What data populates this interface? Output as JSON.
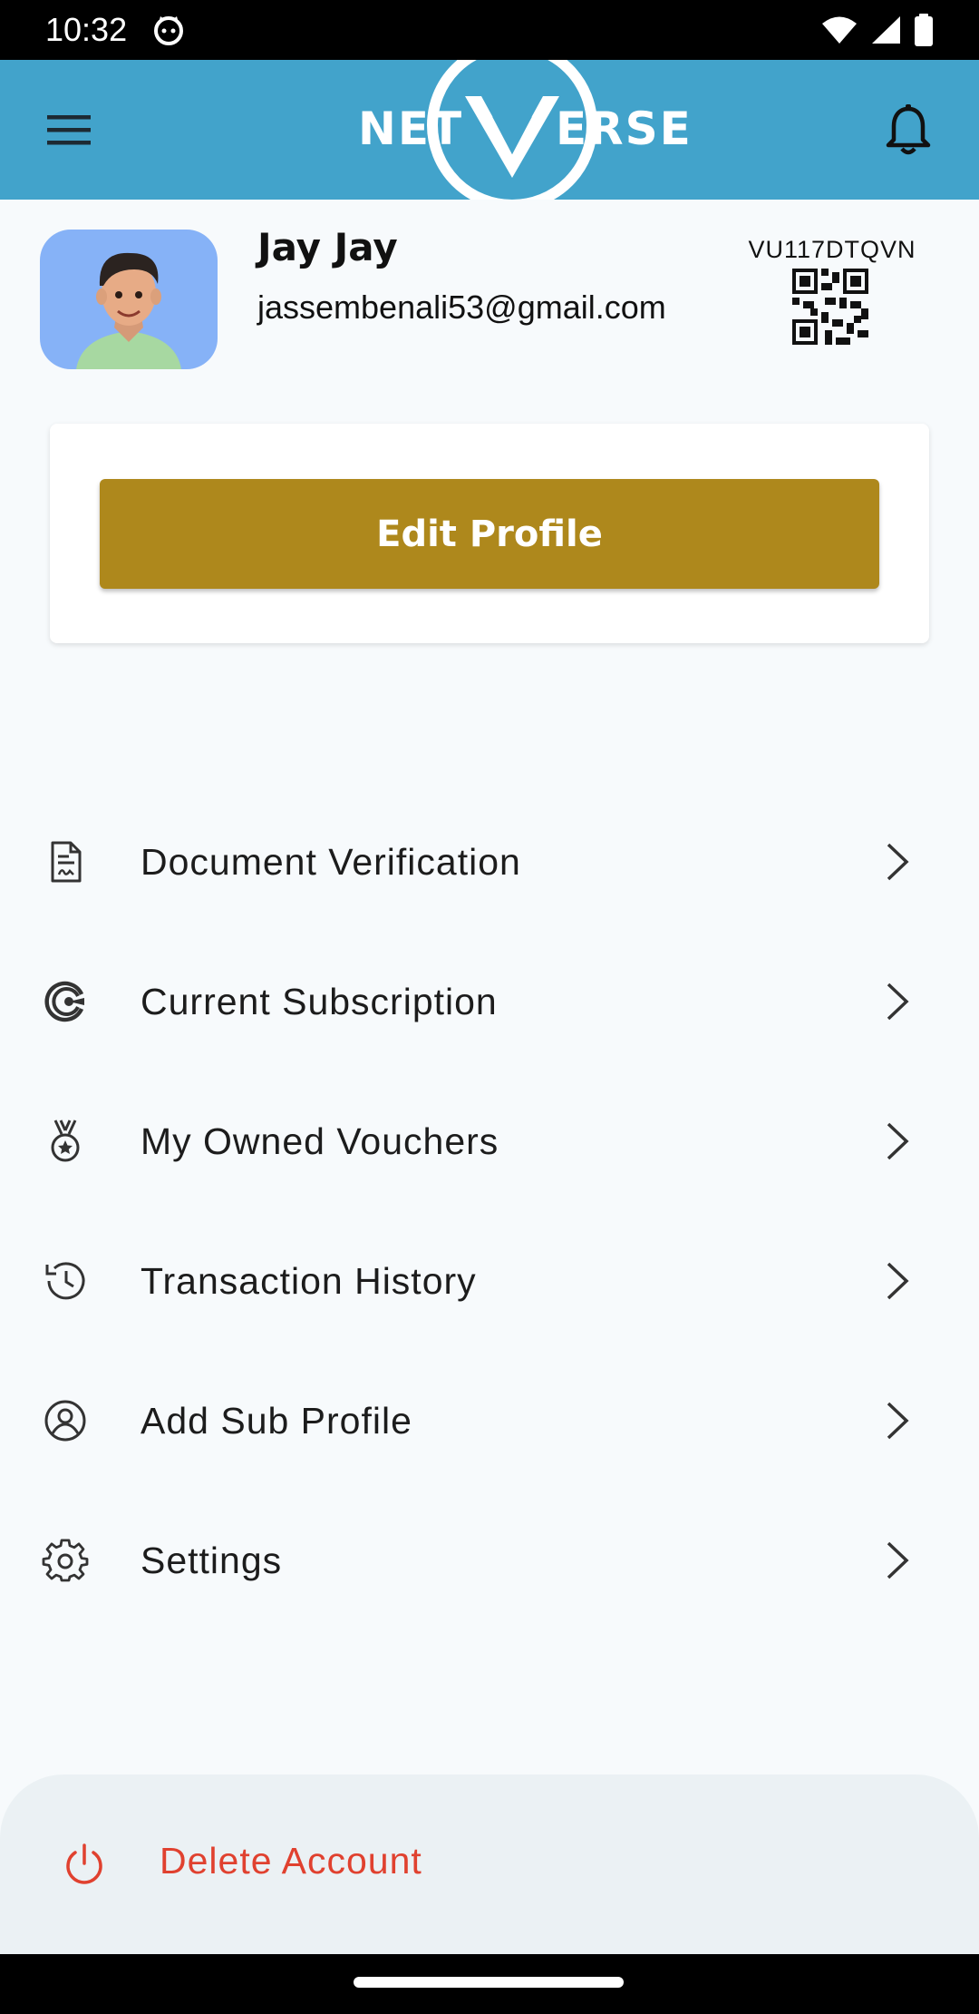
{
  "status_bar": {
    "time": "10:32"
  },
  "app_bar": {
    "logo_left": "NET",
    "logo_right": "ERSE"
  },
  "profile": {
    "name": "Jay Jay",
    "email": "jassembenali53@gmail.com",
    "code": "VU117DTQVN"
  },
  "edit_card": {
    "button_label": "Edit Profile"
  },
  "menu": {
    "items": [
      {
        "label": "Document Verification",
        "icon": "document-icon"
      },
      {
        "label": "Current Subscription",
        "icon": "subscription-icon"
      },
      {
        "label": "My Owned Vouchers",
        "icon": "medal-icon"
      },
      {
        "label": "Transaction History",
        "icon": "history-icon"
      },
      {
        "label": "Add Sub Profile",
        "icon": "user-circle-icon"
      },
      {
        "label": "Settings",
        "icon": "gear-icon"
      }
    ]
  },
  "delete_account": {
    "label": "Delete Account",
    "icon": "power-icon"
  },
  "colors": {
    "app_bar": "#42a3cb",
    "edit_button": "#ae881c",
    "delete_text": "#e0412f",
    "avatar_bg": "#86b2f7"
  }
}
